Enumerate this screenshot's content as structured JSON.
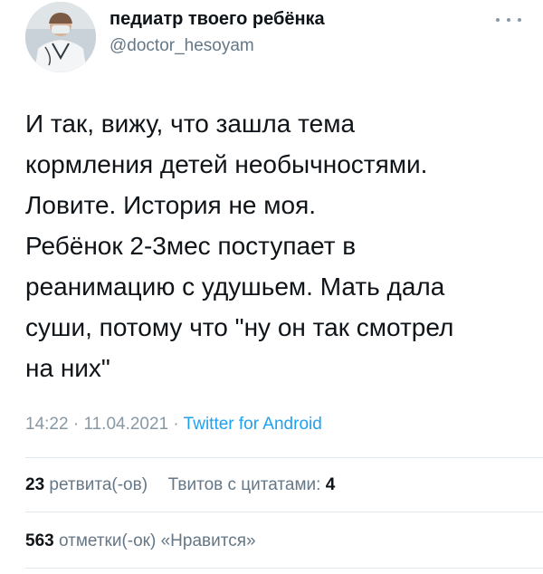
{
  "author": {
    "display_name": "педиатр твоего ребёнка",
    "handle": "@doctor_hesoyam",
    "avatar_icon": "doctor-avatar"
  },
  "tweet": {
    "lines": [
      "И так, вижу, что зашла тема",
      "кормления детей необычностями.",
      "Ловите. История не моя.",
      "Ребёнок 2-3мес поступает в",
      "реанимацию с удушьем. Мать дала",
      "суши, потому что \"ну он так смотрел",
      "на них\""
    ]
  },
  "meta": {
    "time": "14:22",
    "date": "11.04.2021",
    "separator": "·",
    "source": "Twitter for Android"
  },
  "stats": {
    "retweets_count": "23",
    "retweets_label": "ретвита(-ов)",
    "quotes_label": "Твитов с цитатами:",
    "quotes_count": "4",
    "likes_count": "563",
    "likes_label": "отметки(-ок) «Нравится»"
  },
  "colors": {
    "link": "#1da1f2",
    "secondary_text": "#657786",
    "divider": "#e1e8ed"
  }
}
